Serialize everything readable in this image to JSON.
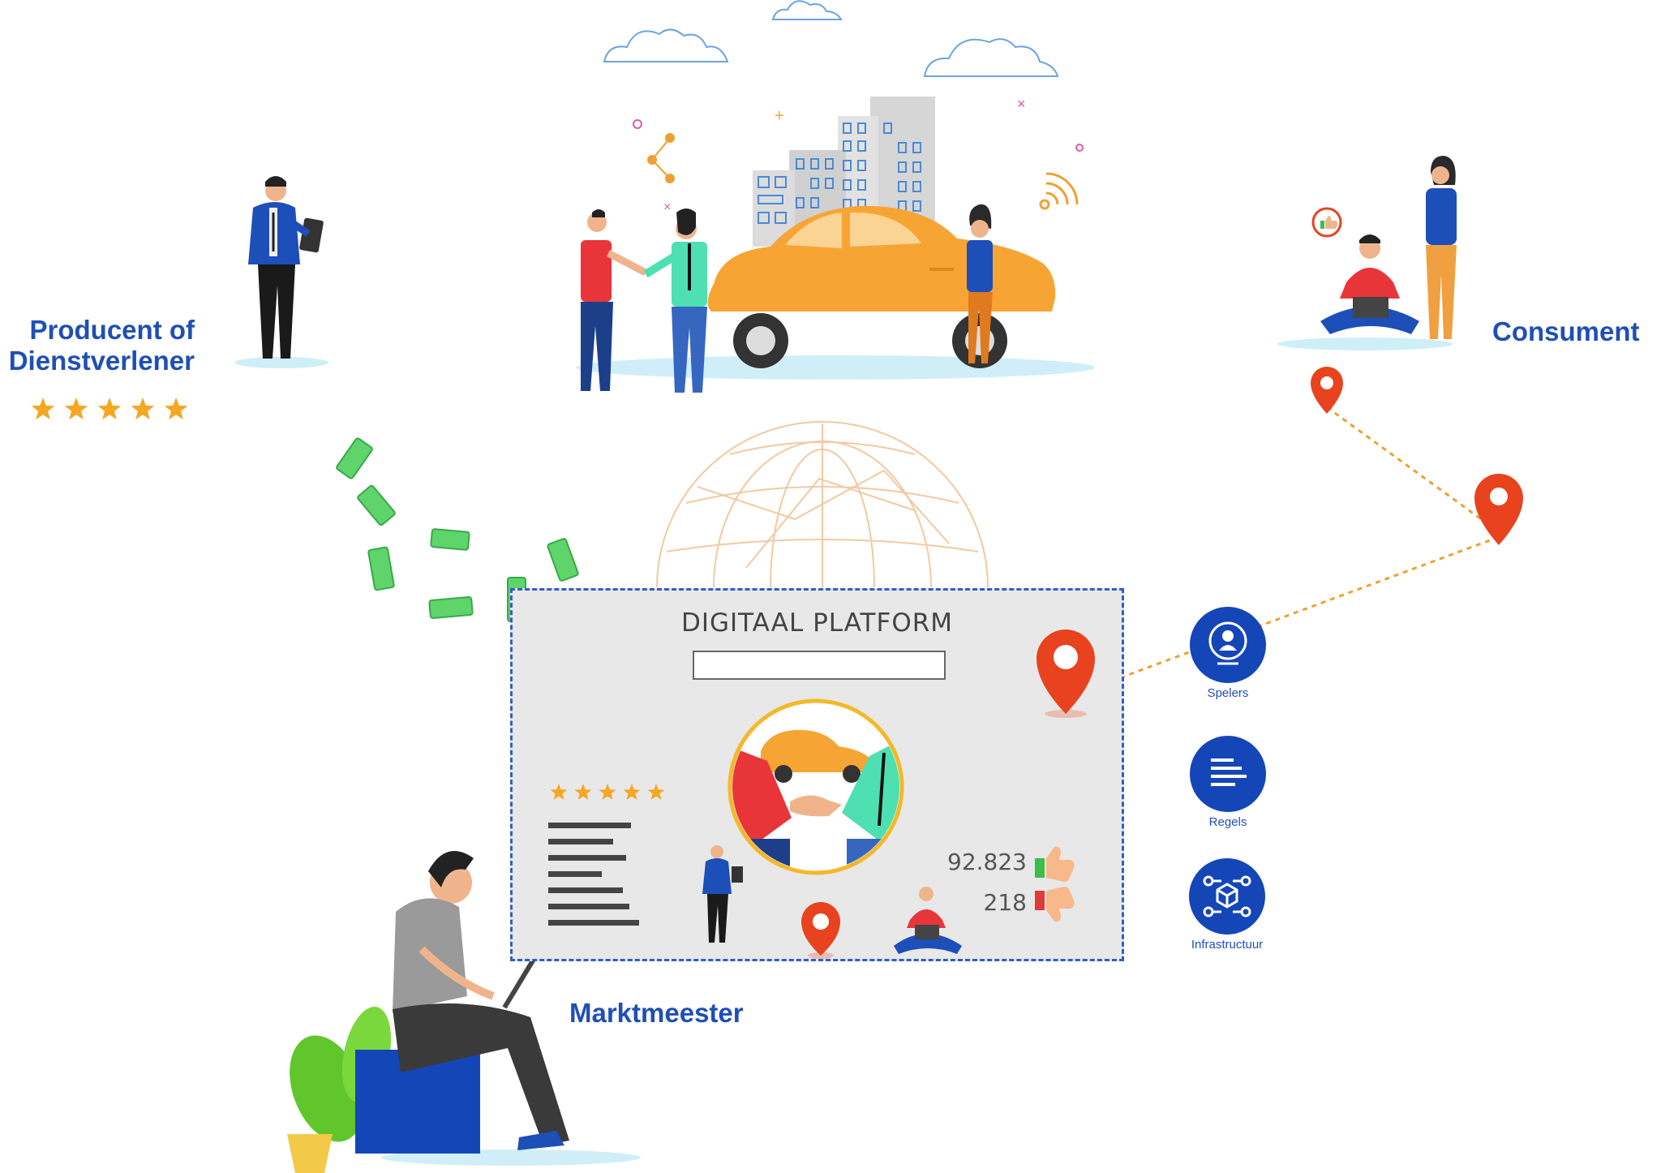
{
  "title": "DIGITAAL PLATFORM",
  "roles": {
    "producer_line1": "Producent of",
    "producer_line2": "Dienstverlener",
    "consumer": "Consument",
    "marketmaster": "Marktmeester"
  },
  "producer_rating_stars": 5,
  "platform_rating_stars": 5,
  "stats": {
    "likes": "92.823",
    "dislikes": "218"
  },
  "pillars": [
    {
      "label": "Spelers",
      "icon": "players-icon"
    },
    {
      "label": "Regels",
      "icon": "rules-icon"
    },
    {
      "label": "Infrastructuur",
      "icon": "infrastructure-icon"
    }
  ],
  "colors": {
    "brand_blue": "#1f4fb5",
    "pillar_blue": "#1446b8",
    "star_orange": "#f5a623",
    "pin_red": "#e8431e",
    "taxi_orange": "#f6a534",
    "money_green": "#5ed46a",
    "dotted_route": "#f0a030",
    "like_green": "#3dbd4a",
    "dislike_red": "#e03a3a"
  }
}
